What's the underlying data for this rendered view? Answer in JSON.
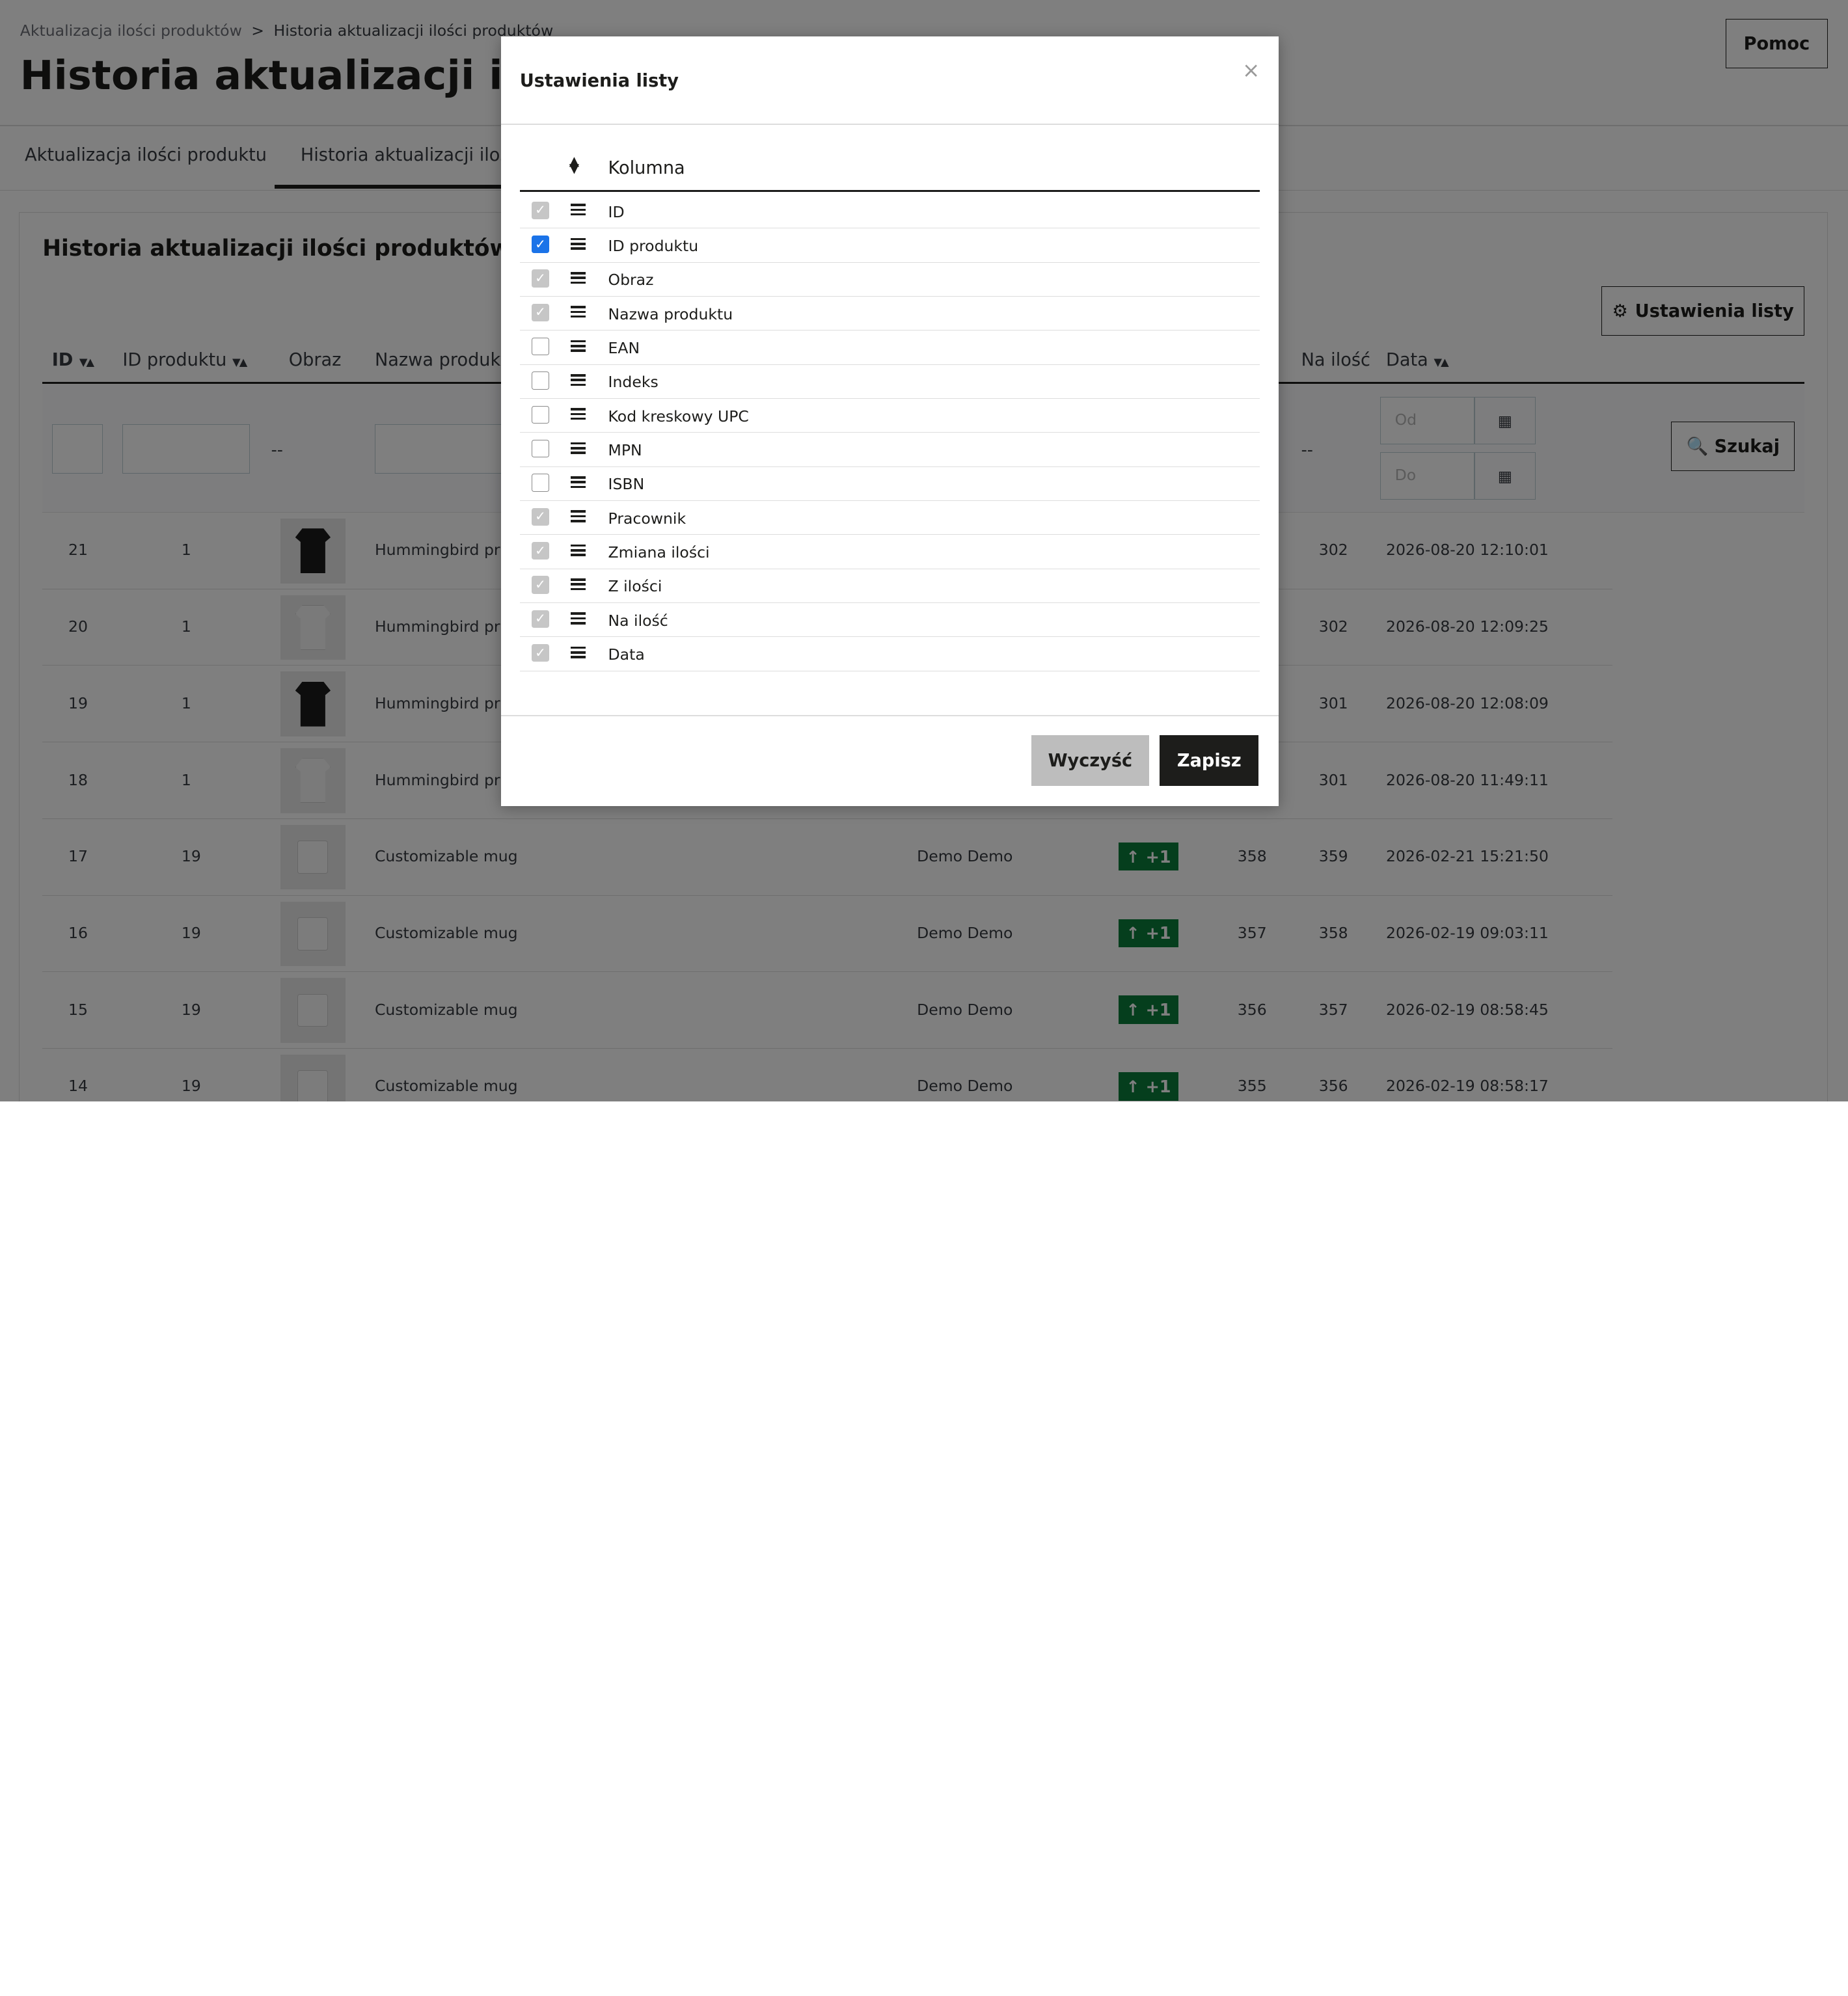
{
  "breadcrumb": {
    "parent": "Aktualizacja ilości produktów",
    "separator": ">",
    "current": "Historia aktualizacji ilości produktów"
  },
  "page_title": "Historia aktualizacji ilości produktów",
  "help_label": "Pomoc",
  "tabs": [
    {
      "label": "Aktualizacja ilości produktu"
    },
    {
      "label": "Historia aktualizacji ilości produktów"
    }
  ],
  "panel": {
    "title": "Historia aktualizacji ilości produktów",
    "list_settings_label": "Ustawienia listy",
    "search_label": "Szukaj",
    "headers": {
      "id": "ID",
      "product_id": "ID produktu",
      "image": "Obraz",
      "name": "Nazwa produktu",
      "to_qty": "Na ilość",
      "date": "Data"
    },
    "filters": {
      "image_dash": "--",
      "to_qty_dash": "--",
      "date_from_placeholder": "Od",
      "date_to_placeholder": "Do"
    },
    "rows": [
      {
        "id": "21",
        "product_id": "1",
        "image": "tshirt-black",
        "name": "Hummingbird printed t-shirt",
        "employee": "",
        "change": "",
        "from_qty": "",
        "to_qty": "302",
        "date": "2026-08-20 12:10:01"
      },
      {
        "id": "20",
        "product_id": "1",
        "image": "tshirt-white",
        "name": "Hummingbird printed t-shirt",
        "employee": "",
        "change": "",
        "from_qty": "",
        "to_qty": "302",
        "date": "2026-08-20 12:09:25"
      },
      {
        "id": "19",
        "product_id": "1",
        "image": "tshirt-black",
        "name": "Hummingbird printed t-shirt",
        "employee": "",
        "change": "",
        "from_qty": "",
        "to_qty": "301",
        "date": "2026-08-20 12:08:09"
      },
      {
        "id": "18",
        "product_id": "1",
        "image": "tshirt-white",
        "name": "Hummingbird printed t-shirt",
        "employee": "",
        "change": "",
        "from_qty": "",
        "to_qty": "301",
        "date": "2026-08-20 11:49:11"
      },
      {
        "id": "17",
        "product_id": "19",
        "image": "mug",
        "name": "Customizable mug",
        "employee": "Demo Demo",
        "change": "+1",
        "from_qty": "358",
        "to_qty": "359",
        "date": "2026-02-21 15:21:50"
      },
      {
        "id": "16",
        "product_id": "19",
        "image": "mug",
        "name": "Customizable mug",
        "employee": "Demo Demo",
        "change": "+1",
        "from_qty": "357",
        "to_qty": "358",
        "date": "2026-02-19 09:03:11"
      },
      {
        "id": "15",
        "product_id": "19",
        "image": "mug",
        "name": "Customizable mug",
        "employee": "Demo Demo",
        "change": "+1",
        "from_qty": "356",
        "to_qty": "357",
        "date": "2026-02-19 08:58:45"
      },
      {
        "id": "14",
        "product_id": "19",
        "image": "mug",
        "name": "Customizable mug",
        "employee": "Demo Demo",
        "change": "+1",
        "from_qty": "355",
        "to_qty": "356",
        "date": "2026-02-19 08:58:17"
      }
    ]
  },
  "modal": {
    "title": "Ustawienia listy",
    "close_glyph": "×",
    "column_header": "Kolumna",
    "columns": [
      {
        "label": "ID",
        "state": "disabled"
      },
      {
        "label": "ID produktu",
        "state": "checked"
      },
      {
        "label": "Obraz",
        "state": "disabled"
      },
      {
        "label": "Nazwa produktu",
        "state": "disabled"
      },
      {
        "label": "EAN",
        "state": "unchecked"
      },
      {
        "label": "Indeks",
        "state": "unchecked"
      },
      {
        "label": "Kod kreskowy UPC",
        "state": "unchecked"
      },
      {
        "label": "MPN",
        "state": "unchecked"
      },
      {
        "label": "ISBN",
        "state": "unchecked"
      },
      {
        "label": "Pracownik",
        "state": "disabled"
      },
      {
        "label": "Zmiana ilości",
        "state": "disabled"
      },
      {
        "label": "Z ilości",
        "state": "disabled"
      },
      {
        "label": "Na ilość",
        "state": "disabled"
      },
      {
        "label": "Data",
        "state": "disabled"
      }
    ],
    "clear_label": "Wyczyść",
    "save_label": "Zapisz"
  },
  "colors": {
    "checkbox_checked": "#1b73e8",
    "badge_green": "#0a7d3b",
    "primary_dark": "#1d1d1b"
  }
}
